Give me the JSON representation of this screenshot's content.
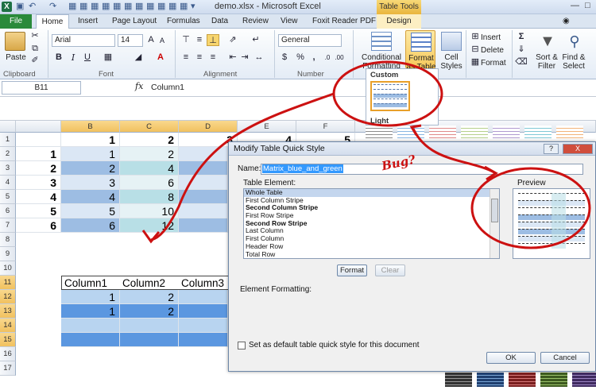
{
  "window": {
    "title": "demo.xlsx - Microsoft Excel",
    "context_tab": "Table Tools"
  },
  "tabs": {
    "file": "File",
    "home": "Home",
    "insert": "Insert",
    "page_layout": "Page Layout",
    "formulas": "Formulas",
    "data": "Data",
    "review": "Review",
    "view": "View",
    "foxit": "Foxit Reader PDF",
    "design": "Design"
  },
  "ribbon": {
    "paste_label": "Paste",
    "clipboard_label": "Clipboard",
    "font_name": "Arial",
    "font_size": "14",
    "font_label": "Font",
    "alignment_label": "Alignment",
    "number_format": "General",
    "number_label": "Number",
    "conditional_label_1": "Conditional",
    "conditional_label_2": "Formatting",
    "format_table_1": "Format",
    "format_table_2": "as Table",
    "cell_styles_1": "Cell",
    "cell_styles_2": "Styles",
    "insert_label": "Insert",
    "delete_label": "Delete",
    "format_label": "Format",
    "sort_label_1": "Sort &",
    "sort_label_2": "Filter",
    "find_label_1": "Find &",
    "find_label_2": "Select",
    "bold": "B",
    "italic": "I",
    "underline": "U",
    "currency": "$",
    "percent": "%",
    "comma": ","
  },
  "formula_bar": {
    "name_box": "B11",
    "fx": "fx",
    "value": "Column1"
  },
  "gallery": {
    "custom_label": "Custom",
    "light_label": "Light"
  },
  "sheet": {
    "columns": [
      "B",
      "C",
      "D",
      "E",
      "F"
    ],
    "rows": [
      "1",
      "2",
      "3",
      "4",
      "5",
      "6",
      "7",
      "8",
      "9",
      "10",
      "11",
      "12",
      "13",
      "14",
      "15",
      "16",
      "17"
    ],
    "row1": [
      "1",
      "2",
      "3",
      "4",
      "5"
    ],
    "a_col": [
      "1",
      "2",
      "3",
      "4",
      "5",
      "6"
    ],
    "b_col": [
      "1",
      "2",
      "3",
      "4",
      "5",
      "6"
    ],
    "c_col": [
      "2",
      "4",
      "6",
      "8",
      "10",
      "12"
    ],
    "table_headers": [
      "Column1",
      "Column2",
      "Column3"
    ],
    "table_row1": [
      "1",
      "2"
    ],
    "table_row2": [
      "1",
      "2"
    ]
  },
  "dialog": {
    "title": "Modify Table Quick Style",
    "help": "?",
    "close": "X",
    "name_label": "Name:",
    "name_value": "Matrix_blue_and_green",
    "table_element_label": "Table Element:",
    "preview_label": "Preview",
    "elements": [
      "Whole Table",
      "First Column Stripe",
      "Second Column Stripe",
      "First Row Stripe",
      "Second Row Stripe",
      "Last Column",
      "First Column",
      "Header Row",
      "Total Row"
    ],
    "format_button": "Format",
    "clear_button": "Clear",
    "element_formatting_label": "Element Formatting:",
    "default_checkbox_label": "Set as default table quick style for this document",
    "ok_button": "OK",
    "cancel_button": "Cancel"
  },
  "annotation": {
    "bug_text": "Bug?",
    "color": "#cc1111"
  },
  "colors": {
    "excel_green": "#1e7145",
    "stripe_blue": "#9dbde3",
    "stripe_green": "#b8dfe6",
    "table_dark": "#5b97e0",
    "selection_orange": "#f1c15f"
  }
}
